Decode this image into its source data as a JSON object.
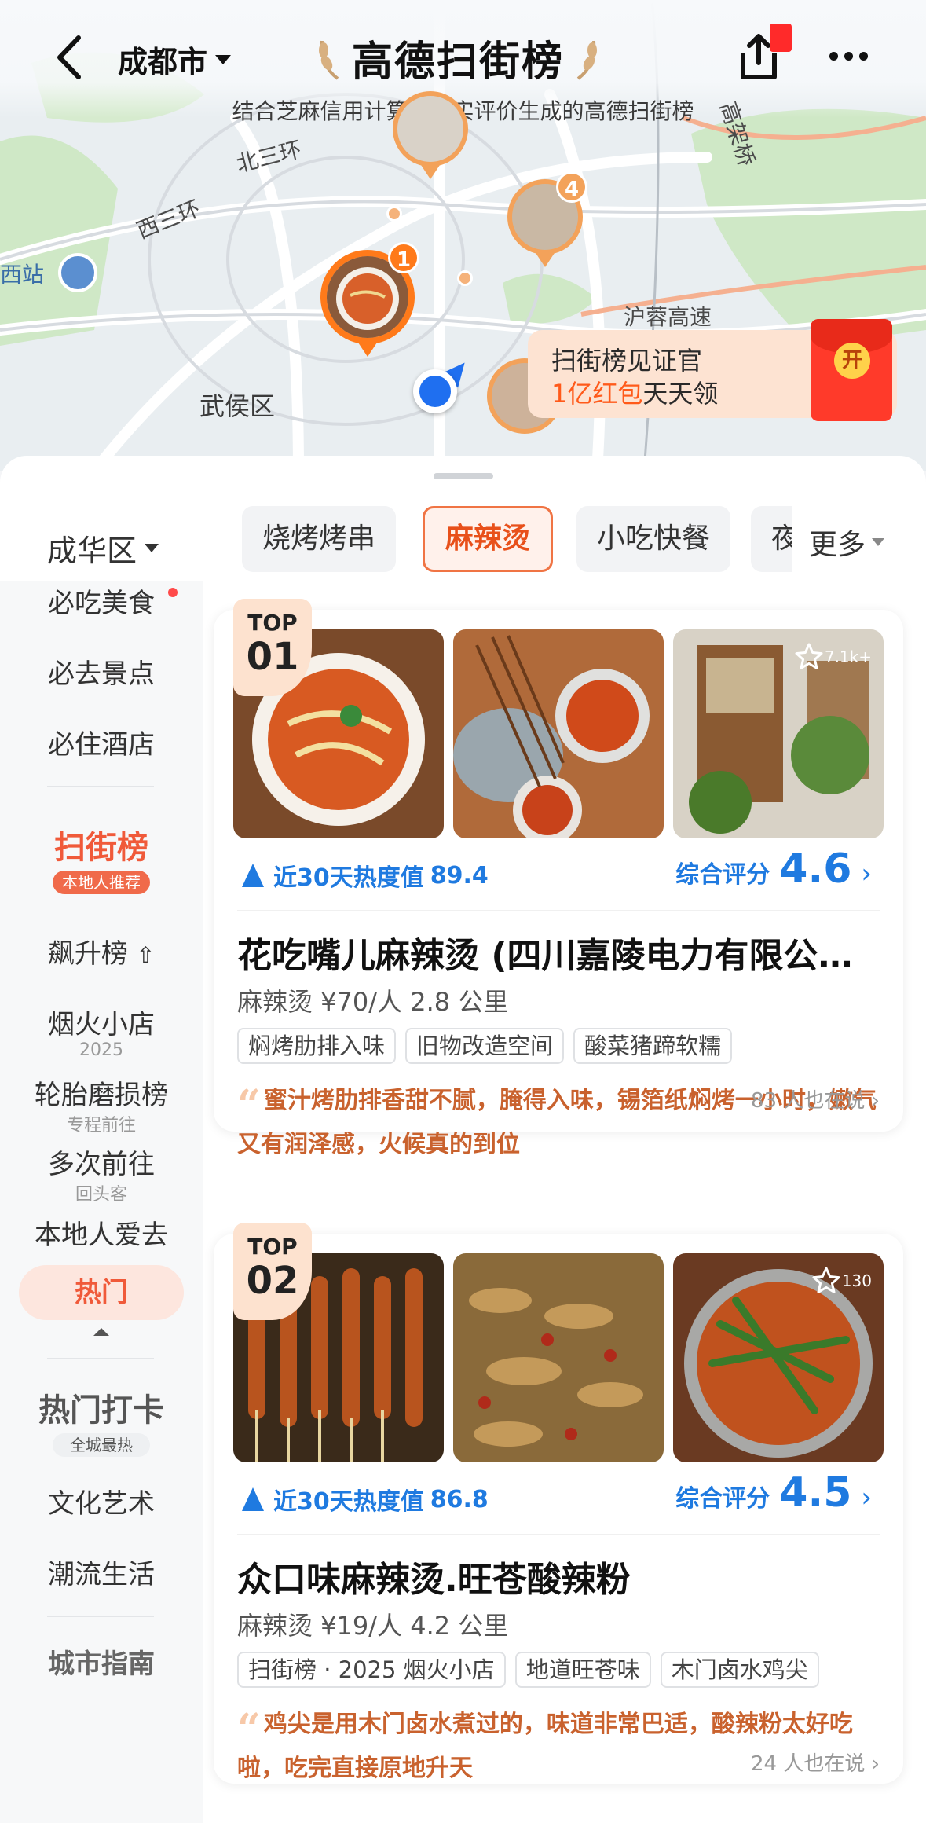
{
  "header": {
    "city": "成都市",
    "title": "高德扫街榜",
    "subtitle": "结合芝麻信用计算的真实评价生成的高德扫街榜"
  },
  "map": {
    "labels": {
      "north_third_ring": "北三环",
      "west_third_ring": "西三环",
      "west_station": "西站",
      "wuhou": "武侯区",
      "hurong": "沪蓉高速",
      "gaojiaqiao": "高架桥"
    },
    "pins": [
      {
        "num": "1"
      },
      {
        "num": "4"
      }
    ]
  },
  "promo": {
    "line1": "扫街榜见证官",
    "line2_highlight": "1亿红包",
    "line2_rest": "天天领",
    "envelope_label": "开"
  },
  "filters": {
    "district": "成华区",
    "categories": [
      {
        "label": "烧烤烤串",
        "active": false
      },
      {
        "label": "麻辣烫",
        "active": true
      },
      {
        "label": "小吃快餐",
        "active": false
      },
      {
        "label": "夜",
        "active": false
      }
    ],
    "more_label": "更多"
  },
  "sidebar": {
    "items": [
      {
        "label": "必吃美食"
      },
      {
        "label": "必去景点"
      },
      {
        "label": "必住酒店"
      }
    ],
    "rank_badge": {
      "title": "扫街榜",
      "sub": "本地人推荐"
    },
    "rank_items": [
      {
        "label": "飙升榜"
      },
      {
        "label": "烟火小店",
        "sub": "2025"
      },
      {
        "label": "轮胎磨损榜",
        "sub": "专程前往"
      },
      {
        "label": "多次前往",
        "sub": "回头客"
      },
      {
        "label": "本地人爱去"
      }
    ],
    "hot_label": "热门",
    "hot_badge": {
      "title": "热门打卡",
      "sub": "全城最热"
    },
    "hot_items": [
      {
        "label": "文化艺术"
      },
      {
        "label": "潮流生活"
      }
    ],
    "partial_label": "城市指南"
  },
  "cards": [
    {
      "rank_top": "TOP",
      "rank_num": "01",
      "fav_count": "7.1k+",
      "heat_label": "近30天热度值",
      "heat_value": "89.4",
      "score_label": "综合评分",
      "score_value": "4.6",
      "name": "花吃嘴儿麻辣烫 (四川嘉陵电力有限公司店)",
      "meta": "麻辣烫  ¥70/人  2.8 公里",
      "tags": [
        "焖烤肋排入味",
        "旧物改造空间",
        "酸菜猪蹄软糯"
      ],
      "quote": "蜜汁烤肋排香甜不腻，腌得入味，锡箔纸焖烤一小时，嫩气又有润泽感，火候真的到位",
      "also": "83 人也在说"
    },
    {
      "rank_top": "TOP",
      "rank_num": "02",
      "fav_count": "130",
      "heat_label": "近30天热度值",
      "heat_value": "86.8",
      "score_label": "综合评分",
      "score_value": "4.5",
      "name": "众口味麻辣烫.旺苍酸辣粉",
      "meta": "麻辣烫  ¥19/人  4.2 公里",
      "tags": [
        "扫街榜 · 2025 烟火小店",
        "地道旺苍味",
        "木门卤水鸡尖"
      ],
      "quote": "鸡尖是用木门卤水煮过的，味道非常巴适，酸辣粉太好吃啦，吃完直接原地升天",
      "also": "24 人也在说"
    }
  ],
  "colors": {
    "accent": "#f05a3a",
    "pin": "#ff7a1a",
    "heat_blue": "#1f7ae0",
    "quote": "#c9622e"
  }
}
